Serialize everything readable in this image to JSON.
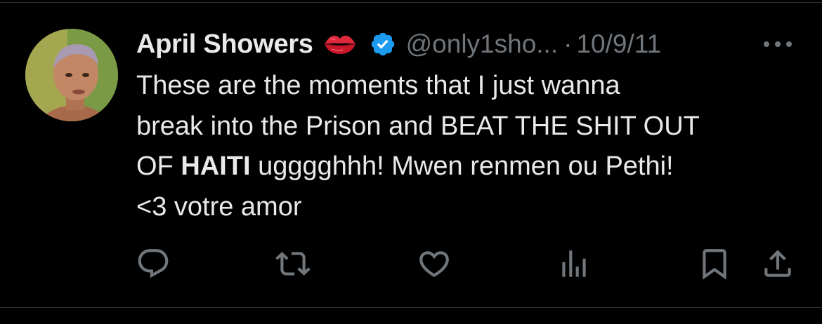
{
  "tweet": {
    "display_name": "April Showers",
    "handle": "@only1sho...",
    "separator": "·",
    "date": "10/9/11",
    "body": {
      "line1": "These are the moments that I just wanna",
      "line2": "break into the Prison and BEAT THE SHIT OUT",
      "line3_prefix": "OF ",
      "line3_bold": "HAITI",
      "line3_suffix": " ugggghhh! Mwen renmen ou Pethi!",
      "line4": "<3 votre amor"
    }
  },
  "icons": {
    "emoji": "lips-icon",
    "verified": "verified-badge-icon",
    "more": "more-icon",
    "reply": "reply-icon",
    "retweet": "retweet-icon",
    "like": "like-icon",
    "views": "views-icon",
    "bookmark": "bookmark-icon",
    "share": "share-icon"
  },
  "colors": {
    "background": "#000000",
    "text_primary": "#e7e9ea",
    "text_secondary": "#71767b",
    "verified_blue": "#1d9bf0",
    "divider": "#2f3336"
  }
}
